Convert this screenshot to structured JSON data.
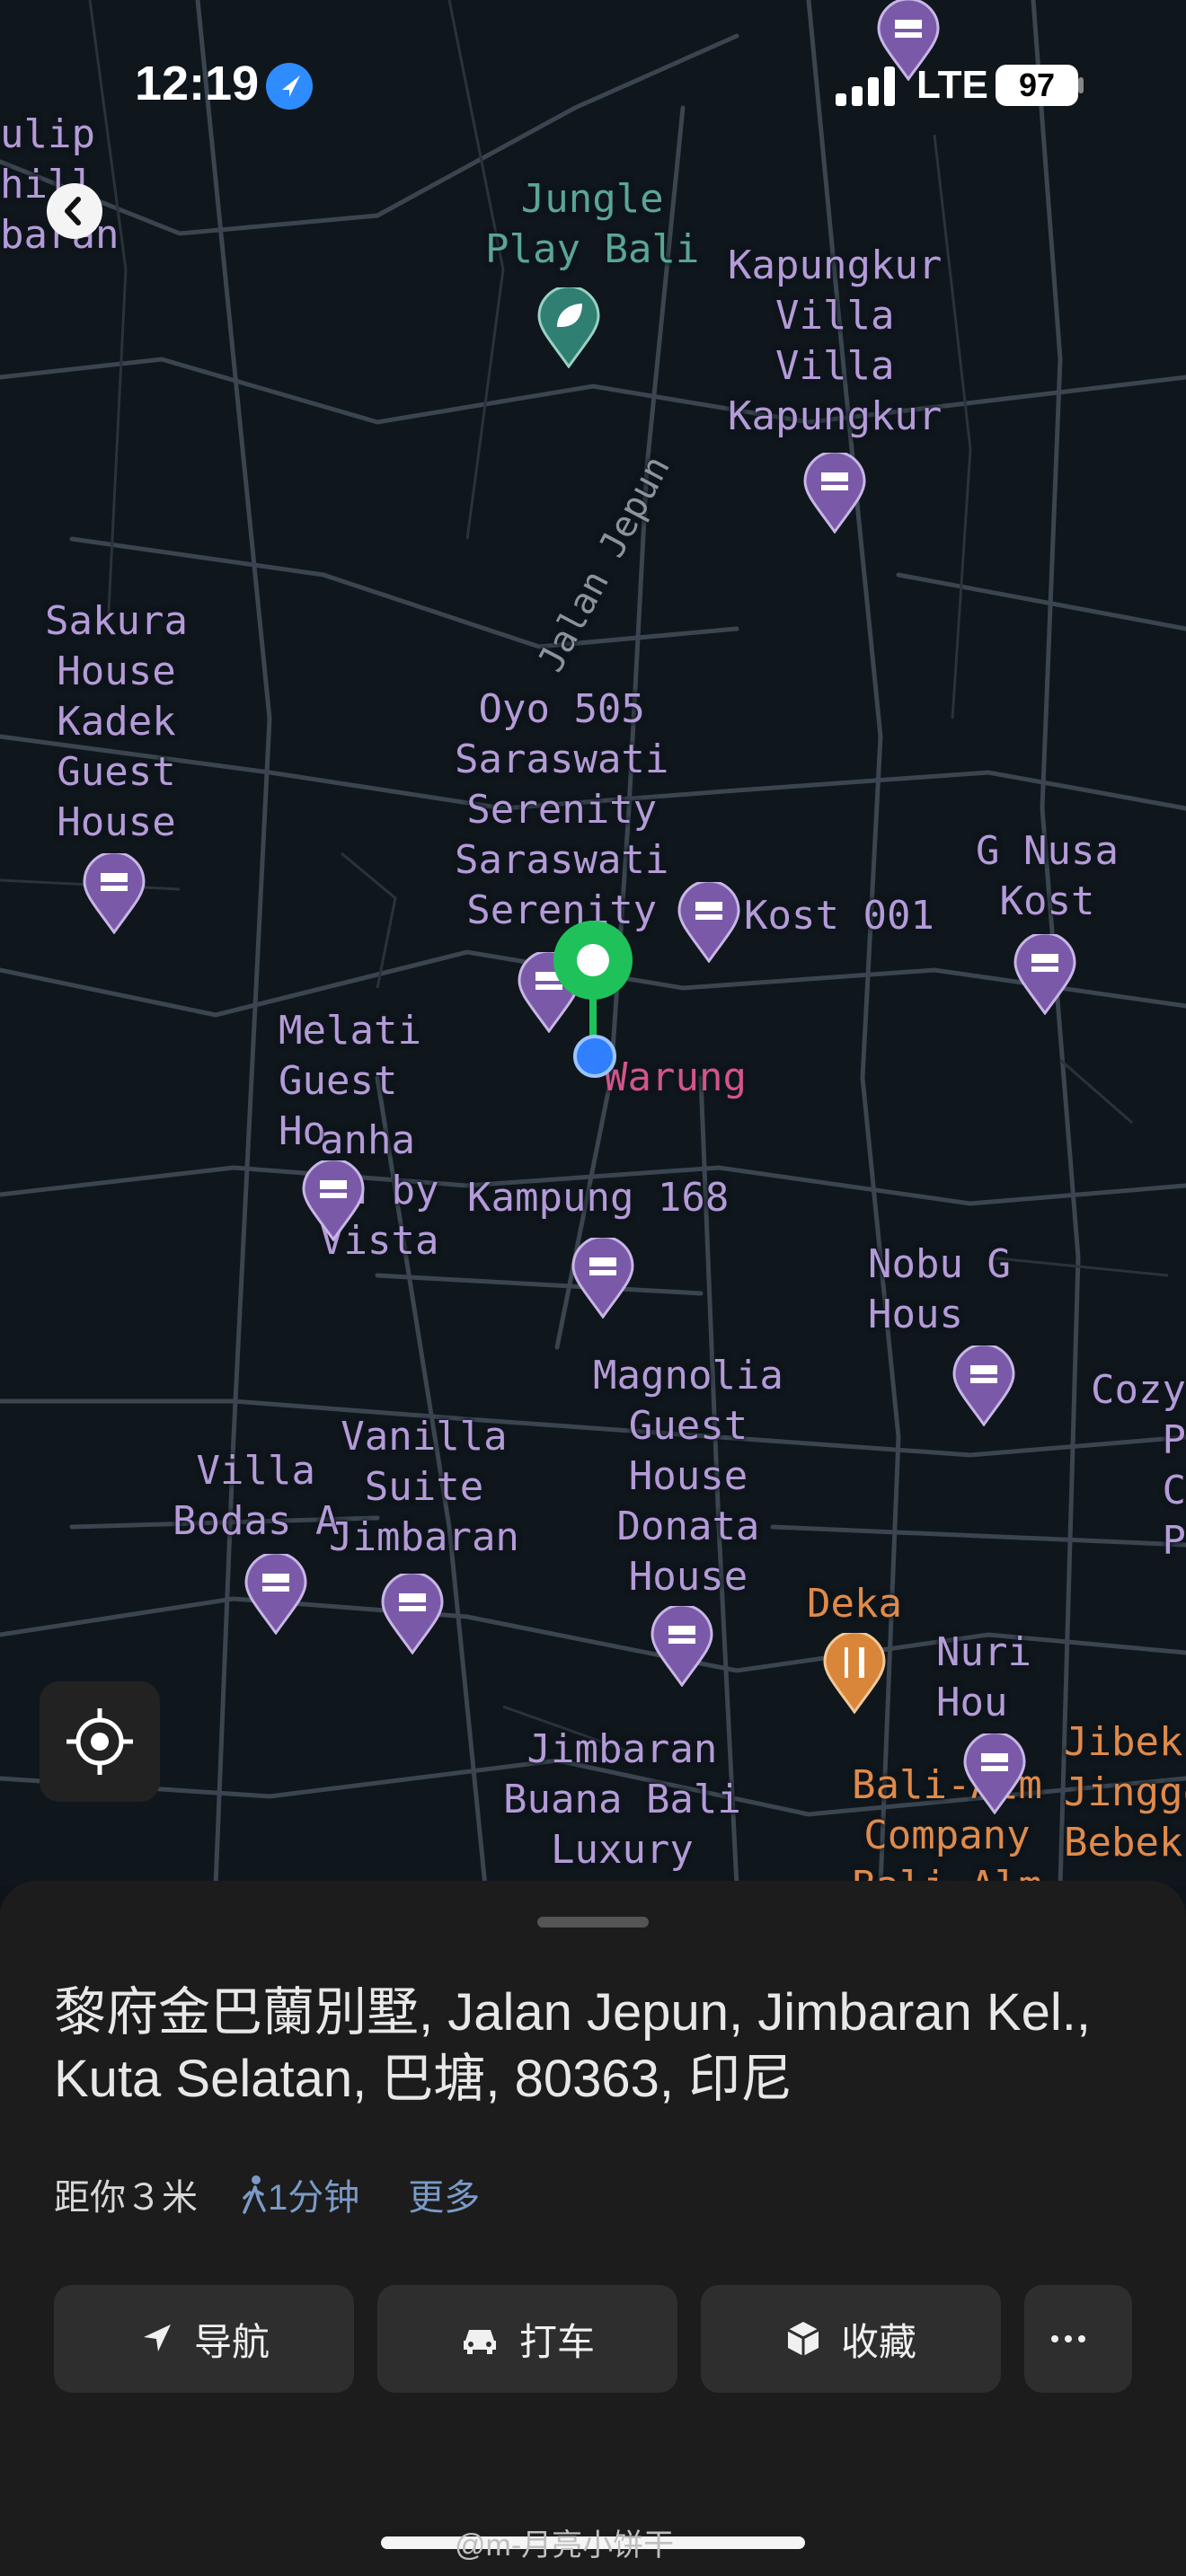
{
  "status_bar": {
    "time": "12:19",
    "network": "LTE",
    "battery": "97"
  },
  "map": {
    "road_labels": [
      "Jalan Jepun"
    ],
    "places": [
      {
        "id": "jungle",
        "name": "Jungle\nPlay Bali",
        "category": "green"
      },
      {
        "id": "kapungkur",
        "name": "Kapungkur\nVilla\nVilla\nKapungkur",
        "category": "purple"
      },
      {
        "id": "tulip",
        "name": "ulip\nhill\nbaran",
        "category": "purple"
      },
      {
        "id": "sakura",
        "name": "Sakura\nHouse\nKadek\nGuest\nHouse",
        "category": "purple"
      },
      {
        "id": "oyo",
        "name": "Oyo 505\nSaraswati\nSerenity\nSaraswati\nSerenity",
        "category": "purple"
      },
      {
        "id": "kost001",
        "name": "Kost 001",
        "category": "purple"
      },
      {
        "id": "gnusa",
        "name": "G Nusa\nKost",
        "category": "purple"
      },
      {
        "id": "melati",
        "name": "Melati\nGuest\nHo",
        "category": "purple"
      },
      {
        "id": "warung",
        "name": "Warung",
        "category": "pink"
      },
      {
        "id": "anha",
        "name": "anha\nan by\nVista",
        "category": "purple"
      },
      {
        "id": "kampung",
        "name": "Kampung 168",
        "category": "purple"
      },
      {
        "id": "nobu",
        "name": "Nobu G\nHous",
        "category": "purple"
      },
      {
        "id": "magnolia",
        "name": "Magnolia\nGuest\nHouse\nDonata\nHouse",
        "category": "purple"
      },
      {
        "id": "cozy",
        "name": "Cozy P\nC\nP",
        "category": "purple"
      },
      {
        "id": "villabodas",
        "name": "Villa\nBodas A",
        "category": "purple"
      },
      {
        "id": "vanilla",
        "name": "Vanilla\nSuite\nJimbaran",
        "category": "purple"
      },
      {
        "id": "deka",
        "name": "Deka",
        "category": "orange"
      },
      {
        "id": "nuri",
        "name": "Nuri\nHou",
        "category": "purple"
      },
      {
        "id": "jibek",
        "name": "Jibek\nJinggo\nBebek",
        "category": "orange"
      },
      {
        "id": "jimbaran",
        "name": "Jimbaran\nBuana Bali\nLuxury",
        "category": "purple"
      },
      {
        "id": "balialm",
        "name": "Bali-Alm\nCompany\nBali-Alm",
        "category": "orange"
      }
    ],
    "colors": {
      "poi_purple": "#7a5aa8",
      "selected_pin": "#1fc25a",
      "food_orange": "#d9863a",
      "park_green": "#2f7f72"
    }
  },
  "sheet": {
    "address": "黎府金巴蘭別墅, Jalan Jepun, Jimbaran Kel., Kuta Selatan, 巴塘, 80363, 印尼",
    "distance": "距你３米",
    "walk_time": "1分钟",
    "more": "更多",
    "actions": [
      {
        "label": "导航",
        "icon": "navigate-arrow-icon"
      },
      {
        "label": "打车",
        "icon": "car-icon"
      },
      {
        "label": "收藏",
        "icon": "cube-icon"
      }
    ]
  },
  "watermark": "@m-月亮小饼干"
}
